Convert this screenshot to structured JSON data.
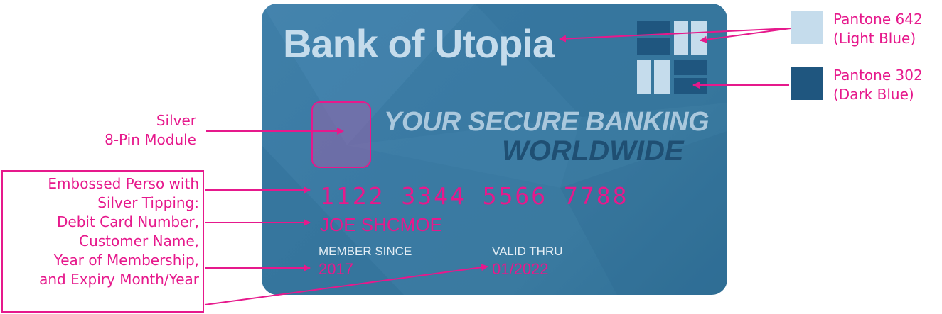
{
  "card": {
    "bank_name": "Bank of Utopia",
    "slogan_line1": "YOUR SECURE BANKING",
    "slogan_line2": "WORLDWIDE",
    "card_number": "1122 3344 5566 7788",
    "holder_name": "JOE SHCMOE",
    "member_since_label": "MEMBER SINCE",
    "member_since_value": "2017",
    "valid_thru_label": "VALID THRU",
    "valid_thru_value": "01/2022"
  },
  "annotations": {
    "chip": [
      "Silver",
      "8-Pin Module"
    ],
    "perso": [
      "Embossed Perso with",
      "Silver Tipping:",
      "Debit Card Number,",
      "Customer Name,",
      "Year of Membership,",
      "and Expiry Month/Year"
    ],
    "pantone_light": [
      "Pantone 642",
      "(Light Blue)"
    ],
    "pantone_dark": [
      "Pantone 302",
      "(Dark Blue)"
    ]
  },
  "colors": {
    "accent": "#e6198c",
    "pantone_642": "#c5dcec",
    "pantone_302": "#1f567f",
    "card_base": "#3a7aa3"
  }
}
